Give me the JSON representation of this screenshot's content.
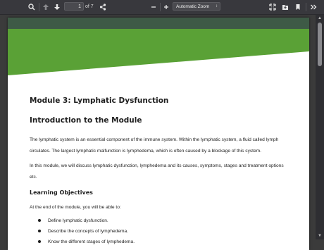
{
  "toolbar": {
    "page_number": "1",
    "page_count_text": "of 7",
    "zoom_label": "Automatic Zoom",
    "icons": [
      "search-icon",
      "arrow-up-icon",
      "arrow-down-icon",
      "share-icon",
      "zoom-out-icon",
      "zoom-in-icon",
      "fullscreen-icon",
      "open-file-icon",
      "bookmark-icon",
      "more-tools-icon"
    ]
  },
  "document": {
    "module_title": "Module 3: Lymphatic Dysfunction",
    "intro_heading": "Introduction to the Module",
    "paragraph1": "The lymphatic system is an essential component of the immune system. Within the lymphatic system, a fluid called lymph circulates. The largest lymphatic malfunction is lymphedema, which is often caused by a blockage of this system.",
    "paragraph2": "In this module, we will discuss lymphatic dysfunction, lymphedema and its causes, symptoms, stages and treatment options etc.",
    "objectives_heading": "Learning Objectives",
    "objectives_intro": "At the end of the module, you will be able to:",
    "objectives": [
      "Define lymphatic dysfunction.",
      "Describe the concepts of lymphedema.",
      "Know the different stages of lymphedema."
    ]
  },
  "colors": {
    "banner_dark": "#3e5a46",
    "banner_green": "#5aa136"
  }
}
